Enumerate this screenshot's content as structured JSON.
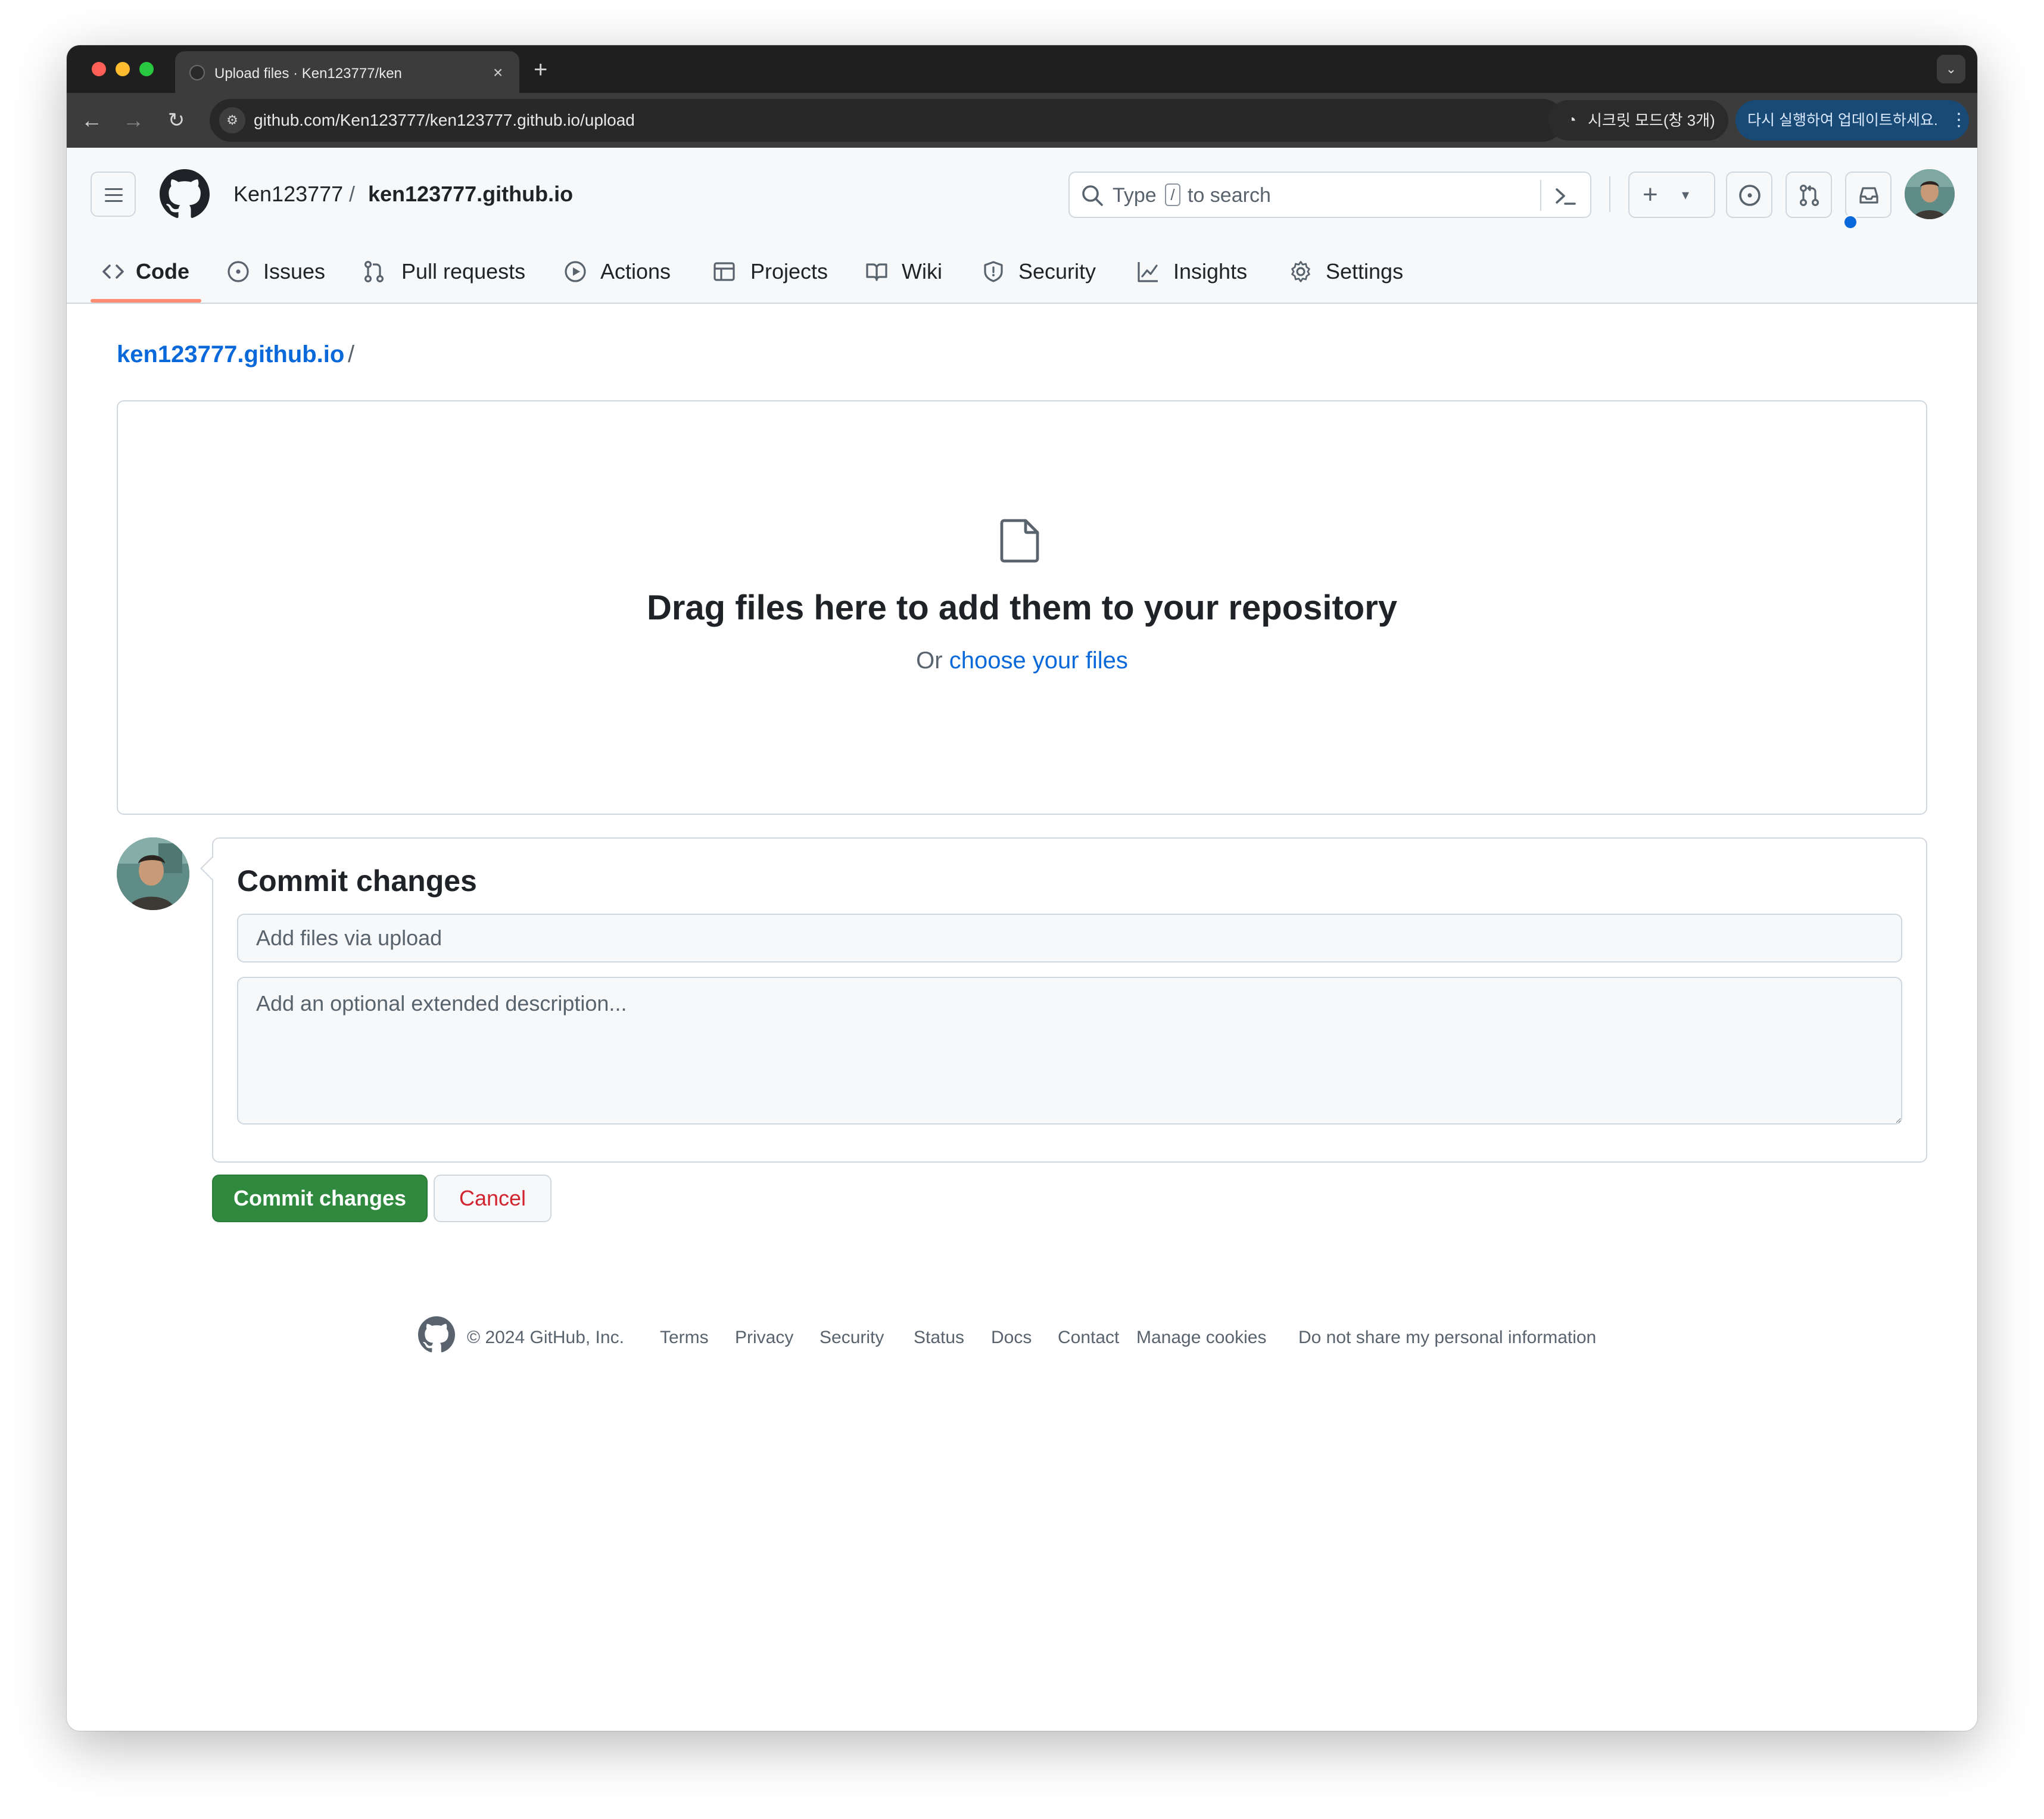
{
  "browser": {
    "tab_title": "Upload files · Ken123777/ken",
    "tab_close": "×",
    "new_tab": "+",
    "tab_search": "⌄",
    "url": "github.com/Ken123777/ken123777.github.io/upload",
    "incognito_label": "시크릿 모드(창 3개)",
    "update_label": "다시 실행하여 업데이트하세요.",
    "update_menu": "⋮"
  },
  "header": {
    "owner": "Ken123777",
    "separator": "/",
    "repo": "ken123777.github.io",
    "search": {
      "prefix": "Type",
      "key": "/",
      "suffix": "to search"
    },
    "plus": "+",
    "caret": "▾"
  },
  "repo_nav": [
    {
      "label": "Code",
      "icon": "code-icon",
      "active": true
    },
    {
      "label": "Issues",
      "icon": "issue-icon"
    },
    {
      "label": "Pull requests",
      "icon": "pull-request-icon"
    },
    {
      "label": "Actions",
      "icon": "play-icon"
    },
    {
      "label": "Projects",
      "icon": "table-icon"
    },
    {
      "label": "Wiki",
      "icon": "book-icon"
    },
    {
      "label": "Security",
      "icon": "shield-icon"
    },
    {
      "label": "Insights",
      "icon": "graph-icon"
    },
    {
      "label": "Settings",
      "icon": "gear-icon"
    }
  ],
  "main": {
    "path_repo": "ken123777.github.io",
    "path_sep": "/",
    "drop_title": "Drag files here to add them to your repository",
    "drop_or": "Or",
    "drop_link": "choose your files",
    "commit_title": "Commit changes",
    "summary_placeholder": "Add files via upload",
    "description_placeholder": "Add an optional extended description...",
    "commit_button": "Commit changes",
    "cancel_button": "Cancel"
  },
  "footer": {
    "copyright": "© 2024 GitHub, Inc.",
    "links": [
      "Terms",
      "Privacy",
      "Security",
      "Status",
      "Docs",
      "Contact",
      "Manage cookies",
      "Do not share my personal information"
    ]
  },
  "colors": {
    "accent_link": "#0969da",
    "commit_green": "#2f8a3f",
    "cancel_red": "#d1242f",
    "nav_underline": "#fd8c73"
  }
}
